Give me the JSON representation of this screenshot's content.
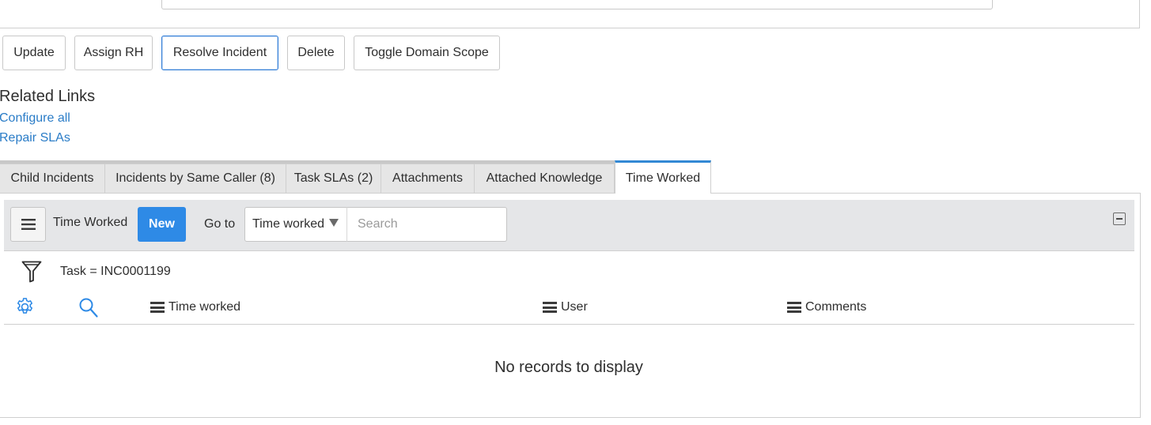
{
  "form_actions": {
    "update": "Update",
    "assign_rh": "Assign RH",
    "resolve_incident": "Resolve Incident",
    "delete": "Delete",
    "toggle_domain_scope": "Toggle Domain Scope"
  },
  "related_links": {
    "title": "Related Links",
    "links": [
      "Configure all",
      "Repair SLAs"
    ]
  },
  "tabs": [
    {
      "label": "Child Incidents",
      "active": false
    },
    {
      "label": "Incidents by Same Caller (8)",
      "active": false
    },
    {
      "label": "Task SLAs (2)",
      "active": false
    },
    {
      "label": "Attachments",
      "active": false
    },
    {
      "label": "Attached Knowledge",
      "active": false
    },
    {
      "label": "Time Worked",
      "active": true
    }
  ],
  "list": {
    "title": "Time Worked",
    "new_label": "New",
    "goto_label": "Go to",
    "goto_selected": "Time worked",
    "search_placeholder": "Search",
    "filter": "Task = INC0001199",
    "columns": [
      "Time worked",
      "User",
      "Comments"
    ],
    "empty_message": "No records to display"
  },
  "icons": {
    "menu": "hamburger-icon",
    "collapse": "collapse-icon",
    "filter": "funnel-icon",
    "settings": "gear-icon",
    "search": "magnifier-icon"
  },
  "colors": {
    "primary_button": "#2e8ae6",
    "link": "#2a7cc7",
    "active_tab_accent": "#3288d4",
    "settings_icon": "#2e8ae6"
  }
}
